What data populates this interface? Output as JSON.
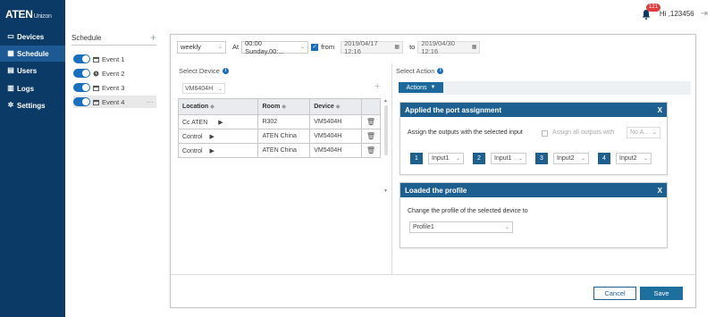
{
  "brand": {
    "name": "ATEN",
    "product": "Unizon"
  },
  "nav": [
    {
      "label": "Devices",
      "icon": "devices-icon"
    },
    {
      "label": "Schedule",
      "icon": "calendar-icon",
      "active": true
    },
    {
      "label": "Users",
      "icon": "users-icon"
    },
    {
      "label": "Logs",
      "icon": "logs-icon"
    },
    {
      "label": "Settings",
      "icon": "gear-icon"
    }
  ],
  "topbar": {
    "notification_count": "121",
    "greeting": "Hi ,123456"
  },
  "schedule": {
    "title": "Schedule",
    "add_symbol": "+",
    "events": [
      {
        "label": "Event 1",
        "icon": "calendar-icon"
      },
      {
        "label": "Event 2",
        "icon": "clock-icon"
      },
      {
        "label": "Event 3",
        "icon": "calendar-icon"
      },
      {
        "label": "Event 4",
        "icon": "calendar-icon",
        "selected": true
      }
    ],
    "more_symbol": "···"
  },
  "timing": {
    "frequency": "weekly",
    "at_label": "At",
    "at_value": "00:00 Sunday,00:...",
    "from_label": "from",
    "from_value": "2019/04/17 12:16",
    "to_label": "to",
    "to_value": "2019/04/30 12:16"
  },
  "device_section": {
    "label": "Select Device",
    "device_selector": "VM6404H",
    "columns": [
      "Location",
      "Room",
      "Device"
    ],
    "rows": [
      {
        "location": "Cc ATEN",
        "room": "R302",
        "device": "VM5404H"
      },
      {
        "location": "Control",
        "room": "ATEN China",
        "device": "VM5404H"
      },
      {
        "location": "Control",
        "room": "ATEN China",
        "device": "VM5404H"
      }
    ]
  },
  "action_section": {
    "label": "Select Action",
    "actions_button": "Actions",
    "port_card": {
      "title": "Applied the port assignment",
      "close": "X",
      "assign_label": "Assign the outputs with the selected input",
      "assign_all_label": "Assign all outputs with",
      "assign_all_value": "No A...",
      "ports": [
        {
          "number": "1",
          "input": "Input1"
        },
        {
          "number": "2",
          "input": "Input1"
        },
        {
          "number": "3",
          "input": "Input2"
        },
        {
          "number": "4",
          "input": "Input2"
        }
      ]
    },
    "profile_card": {
      "title": "Loaded the profile",
      "close": "X",
      "change_label": "Change the profile of the selected device to",
      "profile_value": "Profile1"
    }
  },
  "footer": {
    "cancel": "Cancel",
    "save": "Save"
  },
  "colors": {
    "sidebar": "#0b3a66",
    "accent": "#1d5f8f",
    "badge": "#e23b3b"
  }
}
